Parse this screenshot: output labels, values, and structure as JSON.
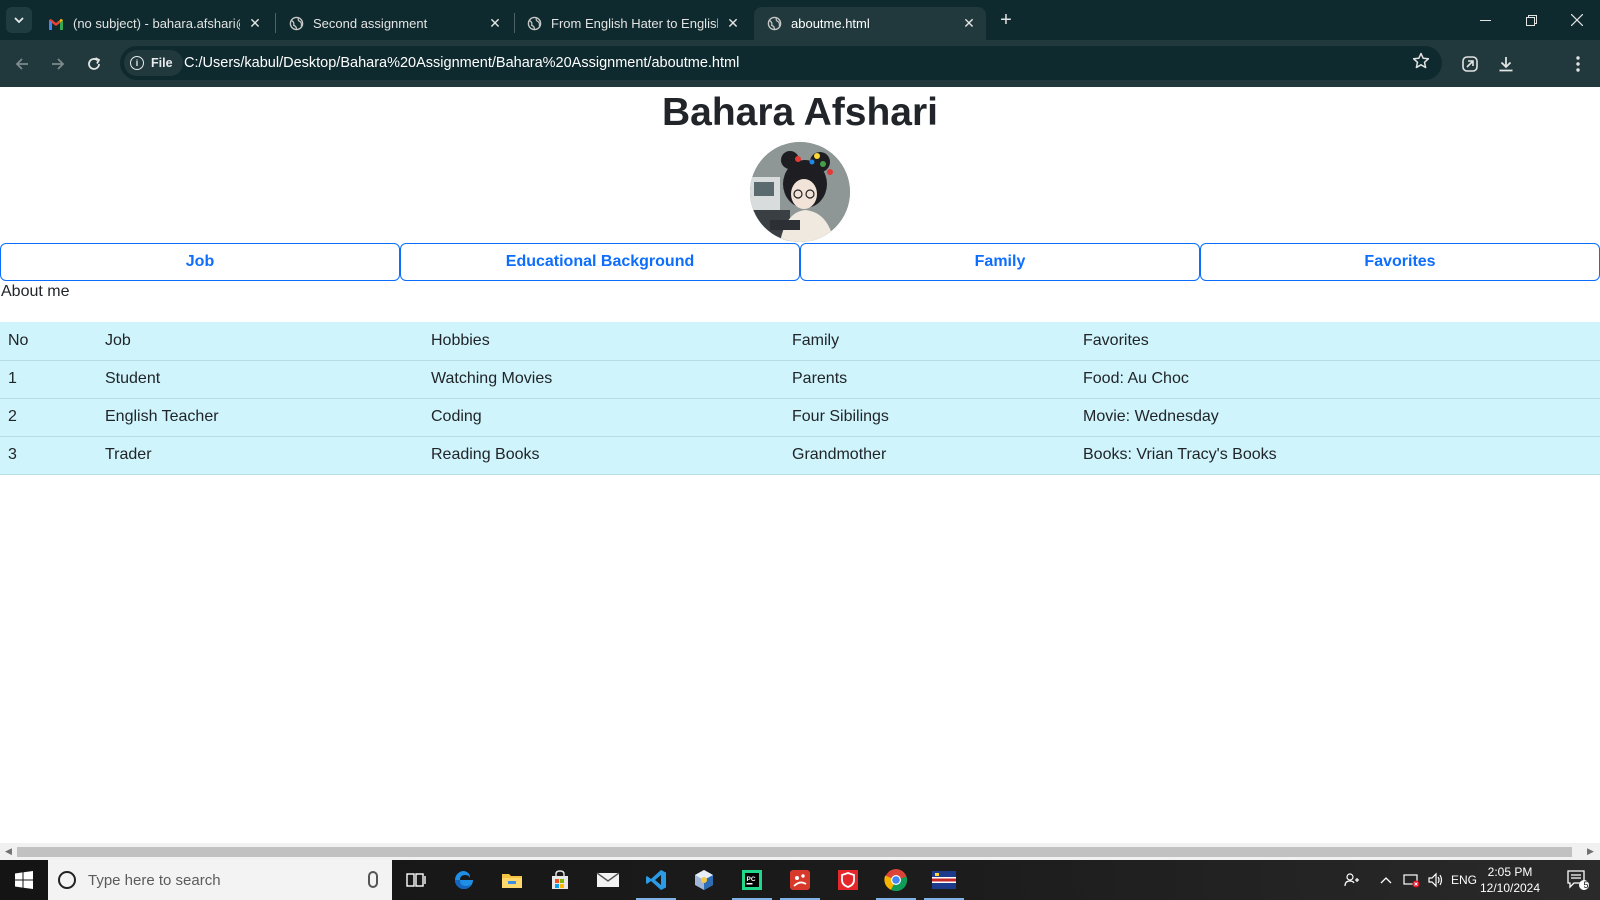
{
  "browser": {
    "tabs": [
      {
        "title": "(no subject) - bahara.afshari@a",
        "icon": "gmail-icon",
        "active": false
      },
      {
        "title": "Second assignment",
        "icon": "globe-icon",
        "active": false
      },
      {
        "title": "From English Hater to English L",
        "icon": "globe-icon",
        "active": false
      },
      {
        "title": "aboutme.html",
        "icon": "globe-icon",
        "active": true
      }
    ],
    "site_chip": "File",
    "url": "C:/Users/kabul/Desktop/Bahara%20Assignment/Bahara%20Assignment/aboutme.html"
  },
  "page": {
    "name": "Bahara Afshari",
    "nav": {
      "job": "Job",
      "education": "Educational Background",
      "family": "Family",
      "favorites": "Favorites"
    },
    "about_label": "About me",
    "table": {
      "headers": [
        "No",
        "Job",
        "Hobbies",
        "Family",
        "Favorites"
      ],
      "rows": [
        [
          "1",
          "Student",
          "Watching Movies",
          "Parents",
          "Food: Au Choc"
        ],
        [
          "2",
          "English Teacher",
          "Coding",
          "Four Sibilings",
          "Movie: Wednesday"
        ],
        [
          "3",
          "Trader",
          "Reading Books",
          "Grandmother",
          "Books: Vrian Tracy's Books"
        ]
      ]
    },
    "colors": {
      "accent": "#0d6efd",
      "table_bg": "#cff4fc",
      "chrome_dark": "#0f2a2e",
      "chrome_toolbar": "#21393d"
    }
  },
  "taskbar": {
    "search_placeholder": "Type here to search",
    "language": "ENG",
    "time": "2:05 PM",
    "date": "12/10/2024",
    "notification_count": "5"
  }
}
